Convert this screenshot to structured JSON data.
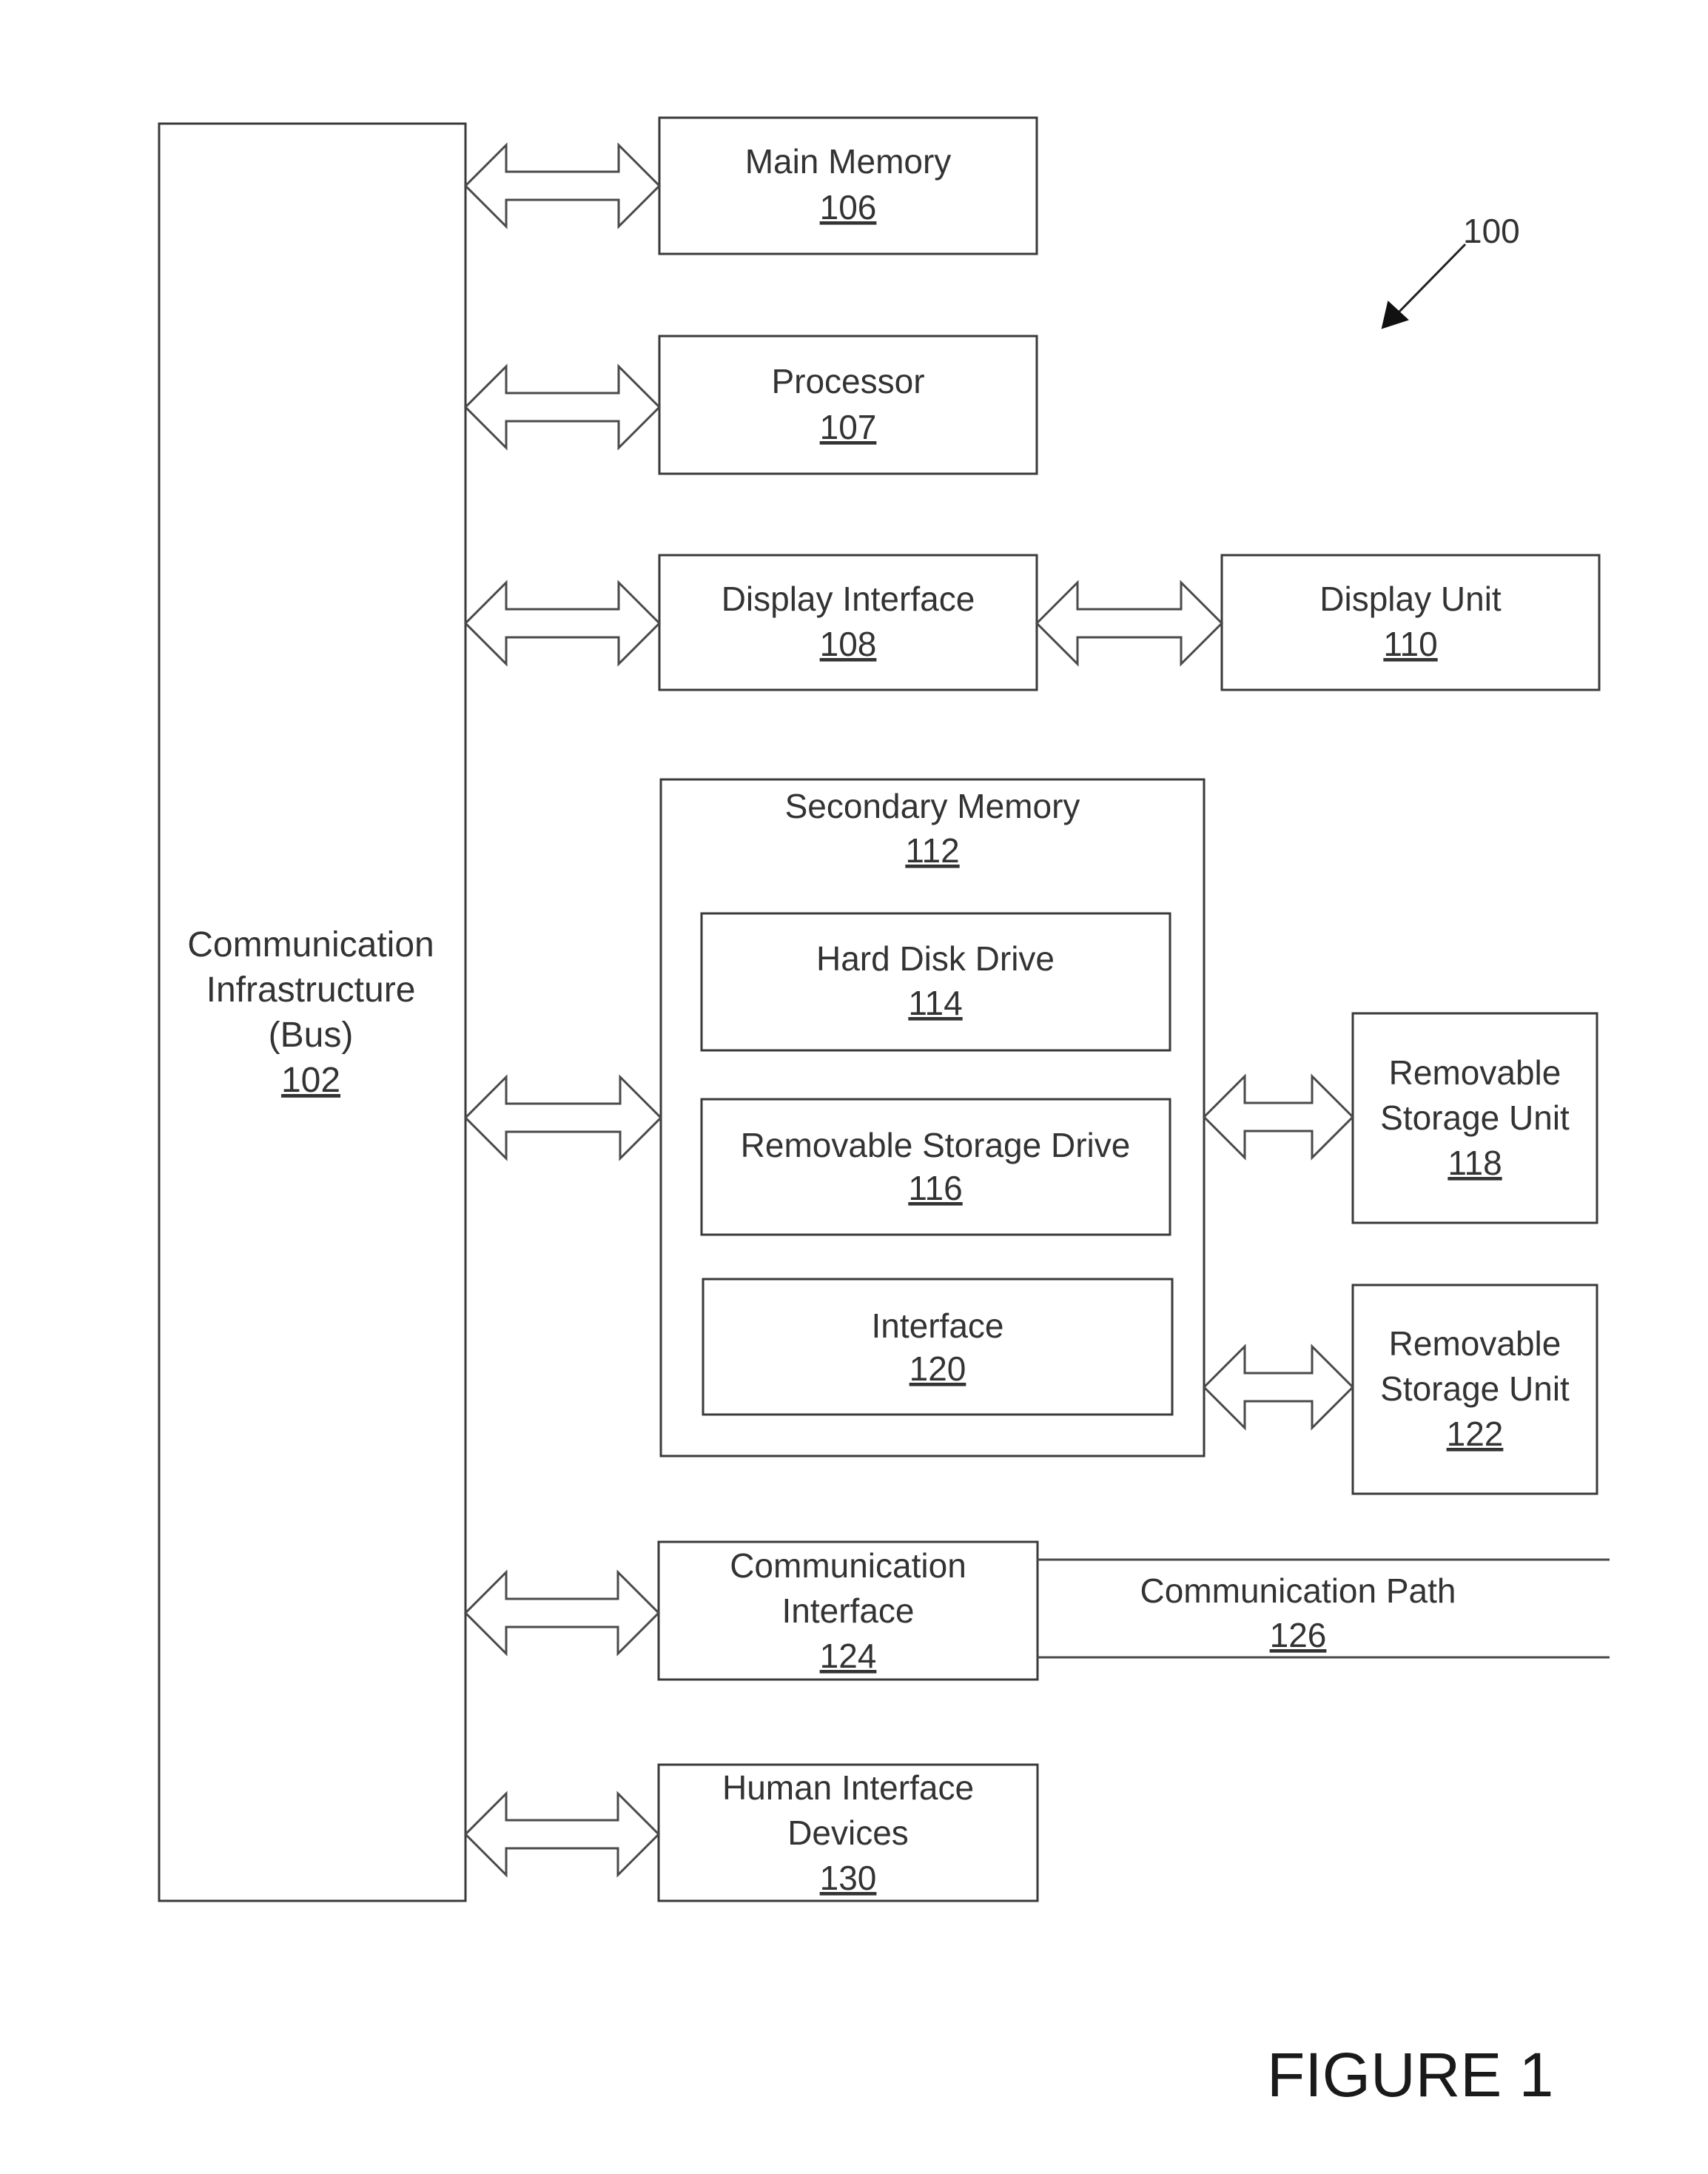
{
  "figure": {
    "caption": "FIGURE 1",
    "reference_number": "100"
  },
  "bus": {
    "lines": [
      "Communication",
      "Infrastructure",
      "(Bus)"
    ],
    "number": "102"
  },
  "main_memory": {
    "lines": [
      "Main Memory"
    ],
    "number": "106"
  },
  "processor": {
    "lines": [
      "Processor"
    ],
    "number": "107"
  },
  "display_interface": {
    "lines": [
      "Display Interface"
    ],
    "number": "108"
  },
  "display_unit": {
    "lines": [
      "Display Unit"
    ],
    "number": "110"
  },
  "secondary_memory": {
    "lines": [
      "Secondary Memory"
    ],
    "number": "112"
  },
  "hard_disk_drive": {
    "lines": [
      "Hard Disk Drive"
    ],
    "number": "114"
  },
  "removable_storage_drive": {
    "lines": [
      "Removable Storage Drive"
    ],
    "number": "116"
  },
  "removable_storage_unit_118": {
    "lines": [
      "Removable",
      "Storage Unit"
    ],
    "number": "118"
  },
  "interface": {
    "lines": [
      "Interface"
    ],
    "number": "120"
  },
  "removable_storage_unit_122": {
    "lines": [
      "Removable",
      "Storage Unit"
    ],
    "number": "122"
  },
  "communication_interface": {
    "lines": [
      "Communication",
      "Interface"
    ],
    "number": "124"
  },
  "communication_path": {
    "lines": [
      "Communication Path"
    ],
    "number": "126"
  },
  "human_interface_devices": {
    "lines": [
      "Human Interface",
      "Devices"
    ],
    "number": "130"
  },
  "connections": [
    {
      "from": "102",
      "to": "106",
      "type": "bidirectional"
    },
    {
      "from": "102",
      "to": "107",
      "type": "bidirectional"
    },
    {
      "from": "102",
      "to": "108",
      "type": "bidirectional"
    },
    {
      "from": "108",
      "to": "110",
      "type": "bidirectional"
    },
    {
      "from": "102",
      "to": "112",
      "type": "bidirectional"
    },
    {
      "from": "112",
      "to": "118",
      "type": "bidirectional"
    },
    {
      "from": "112",
      "to": "122",
      "type": "bidirectional"
    },
    {
      "from": "102",
      "to": "124",
      "type": "bidirectional"
    },
    {
      "from": "124",
      "to": "126",
      "type": "path"
    },
    {
      "from": "102",
      "to": "130",
      "type": "bidirectional"
    }
  ]
}
